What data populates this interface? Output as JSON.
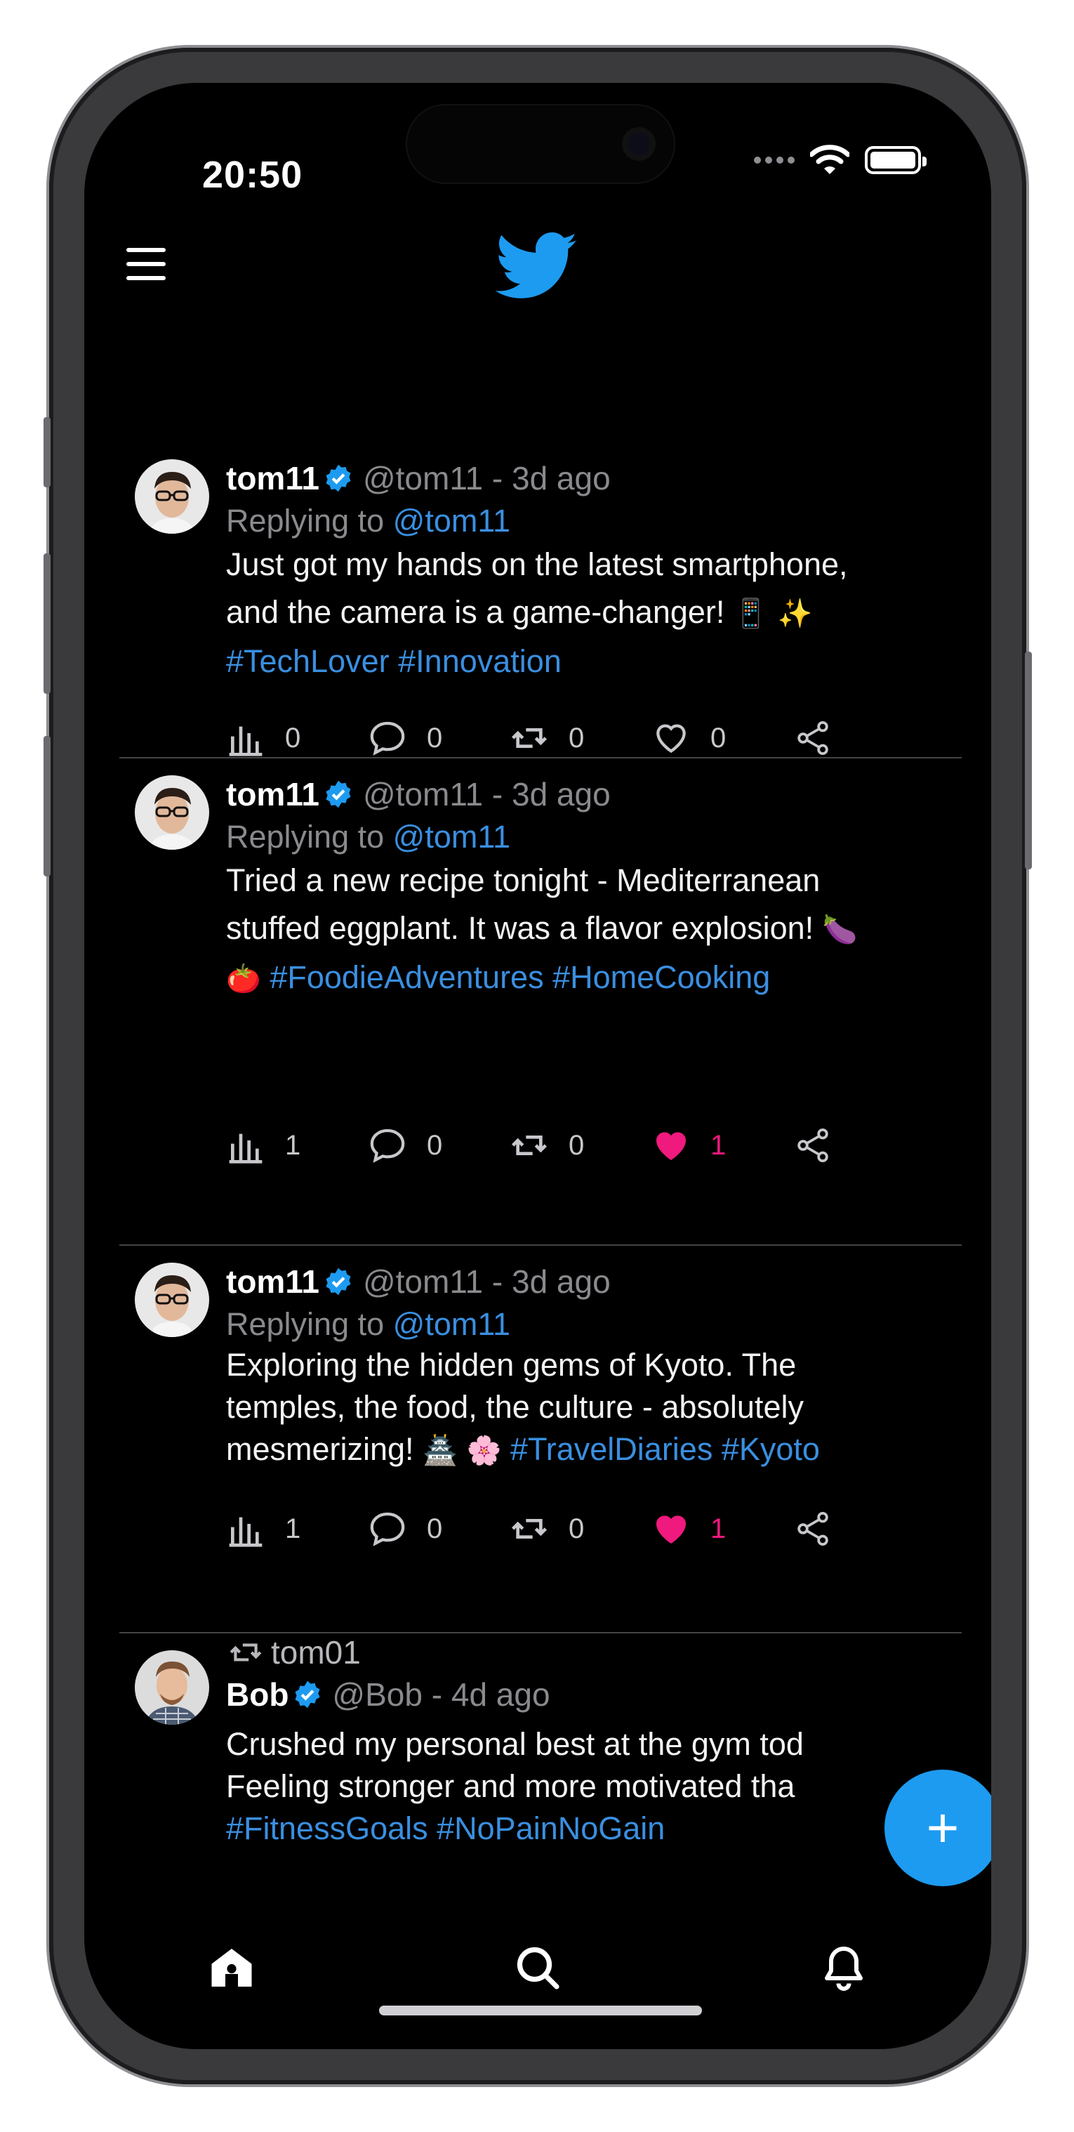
{
  "status_bar": {
    "time": "20:50"
  },
  "header": {
    "menu_icon": "hamburger-icon",
    "logo_icon": "twitter-bird-icon",
    "logo_color": "#1d9bf0"
  },
  "colors": {
    "link": "#3a8fe0",
    "like": "#f0197d",
    "verified": "#1d9bf0",
    "fab": "#1d9bf0"
  },
  "tweets": [
    {
      "name": "tom11",
      "handle": "@tom11",
      "time": "3d ago",
      "replying_label": "Replying to",
      "replying_to": "@tom11",
      "text_1": "Just got my hands on the latest smartphone,",
      "text_2": "and the camera is a game-changer!",
      "emoji_2": "📱 ✨",
      "tags": "#TechLover #Innovation",
      "views": "0",
      "comments": "0",
      "retweets": "0",
      "likes": "0",
      "liked": false
    },
    {
      "name": "tom11",
      "handle": "@tom11",
      "time": "3d ago",
      "replying_label": "Replying to",
      "replying_to": "@tom11",
      "text_1": "Tried a new recipe tonight - Mediterranean",
      "text_2": "stuffed eggplant. It was a flavor explosion!",
      "emoji_2": "🍆",
      "emoji_3": "🍅",
      "tags": "#FoodieAdventures #HomeCooking",
      "views": "1",
      "comments": "0",
      "retweets": "0",
      "likes": "1",
      "liked": true
    },
    {
      "name": "tom11",
      "handle": "@tom11",
      "time": "3d ago",
      "replying_label": "Replying to",
      "replying_to": "@tom11",
      "text_1": "Exploring the hidden gems of Kyoto. The",
      "text_2": "temples, the food, the culture - absolutely",
      "text_3": "mesmerizing!",
      "emoji_3": "🏯 🌸",
      "tags": "#TravelDiaries #Kyoto",
      "views": "1",
      "comments": "0",
      "retweets": "0",
      "likes": "1",
      "liked": true
    },
    {
      "retweeted_by": "tom01",
      "name": "Bob",
      "handle": "@Bob",
      "time": "4d ago",
      "text_1": "Crushed my personal best at the gym tod",
      "text_2": "Feeling stronger and more motivated tha",
      "tags": "#FitnessGoals #NoPainNoGain"
    }
  ],
  "fab": {
    "label": "+"
  },
  "bottom_nav": [
    {
      "id": "home",
      "icon": "home-icon",
      "active": true
    },
    {
      "id": "search",
      "icon": "search-icon",
      "active": false
    },
    {
      "id": "notifications",
      "icon": "bell-icon",
      "active": false
    }
  ]
}
